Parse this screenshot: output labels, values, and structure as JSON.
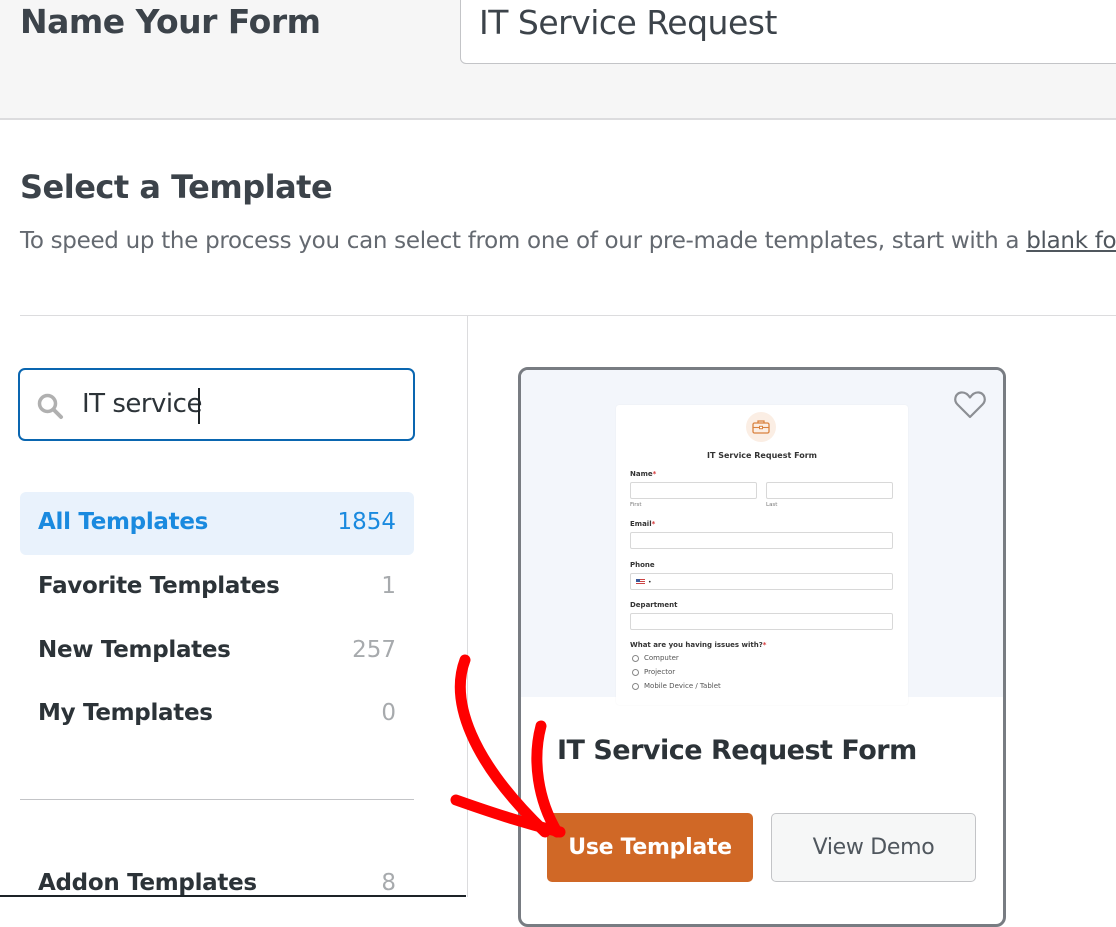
{
  "header": {
    "form_name_label": "Name Your Form",
    "form_name_value": "IT Service Request"
  },
  "section": {
    "title": "Select a Template",
    "description_prefix": "To speed up the process you can select from one of our pre-made templates, start with a ",
    "blank_form_link": "blank form",
    "description_suffix": " o"
  },
  "search": {
    "value": "IT service",
    "icon": "search-icon"
  },
  "categories": [
    {
      "label": "All Templates",
      "count": "1854",
      "active": true
    },
    {
      "label": "Favorite Templates",
      "count": "1",
      "active": false
    },
    {
      "label": "New Templates",
      "count": "257",
      "active": false
    },
    {
      "label": "My Templates",
      "count": "0",
      "active": false
    },
    {
      "label": "Addon Templates",
      "count": "8",
      "active": false
    }
  ],
  "template_card": {
    "name": "IT Service Request Form",
    "favorite_icon": "heart-outline-icon",
    "use_label": "Use Template",
    "demo_label": "View Demo",
    "preview": {
      "icon": "briefcase-icon",
      "title": "IT Service Request Form",
      "name_label": "Name",
      "first_sub": "First",
      "last_sub": "Last",
      "email_label": "Email",
      "phone_label": "Phone",
      "department_label": "Department",
      "question_label": "What are you having issues with?",
      "required_mark": "*",
      "options": [
        "Computer",
        "Projector",
        "Mobile Device / Tablet"
      ]
    }
  },
  "colors": {
    "accent_blue": "#1a8adf",
    "search_border": "#0a66b0",
    "use_button": "#d06826",
    "annotation_arrow": "#ff0000"
  }
}
